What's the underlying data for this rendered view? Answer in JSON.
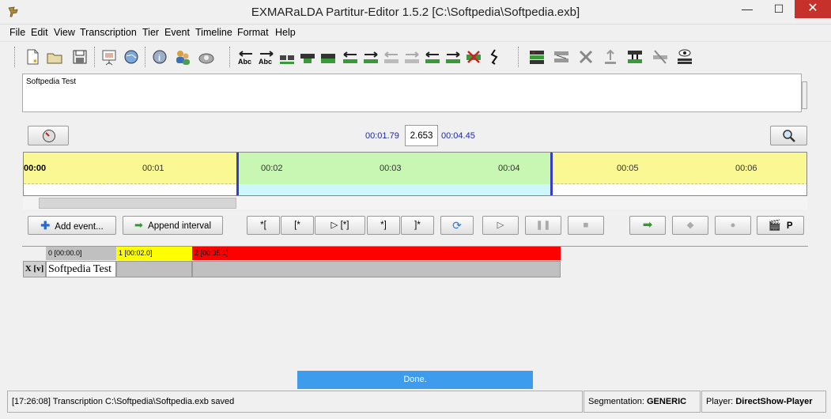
{
  "window": {
    "title": "EXMARaLDA Partitur-Editor 1.5.2 [C:\\Softpedia\\Softpedia.exb]",
    "minimize": "—",
    "maximize": "☐",
    "close": "✕"
  },
  "menu": [
    "File",
    "Edit",
    "View",
    "Transcription",
    "Tier",
    "Event",
    "Timeline",
    "Format",
    "Help"
  ],
  "notes": {
    "text": "Softpedia Test"
  },
  "time_display": {
    "start": "00:01.79",
    "duration": "2.653",
    "end": "00:04.45"
  },
  "timeline": {
    "labels": [
      "00:00",
      "00:01",
      "00:02",
      "00:03",
      "00:04",
      "00:05",
      "00:06"
    ],
    "selection_start_s": 1.79,
    "selection_end_s": 4.45
  },
  "controls": {
    "add_event": "Add event...",
    "append_interval": "Append interval",
    "btn_bracket_start": "*[",
    "btn_star_start": "[*",
    "btn_play_selection": "▷ [*]",
    "btn_star_end": "*]",
    "btn_bracket_end": "]*",
    "btn_p": "P"
  },
  "partitur": {
    "timeline_points": [
      "0 [00:00.0]",
      "1 [00:02.0]",
      "2 [00:35.1]"
    ],
    "tier_label": "X [v]",
    "event_text": "Softpedia Test"
  },
  "progress": {
    "text": "Done."
  },
  "status": {
    "message": "[17:26:08] Transcription C:\\Softpedia\\Softpedia.exb saved",
    "segmentation_label": "Segmentation:",
    "segmentation_value": "GENERIC",
    "player_label": "Player:",
    "player_value": "DirectShow-Player"
  },
  "colors": {
    "timeline_yellow": "#faf892",
    "selection_green": "#c8f7b3",
    "selection_cyan": "#cdf7fb",
    "tl_point0": "#c0c0c0",
    "tl_point1": "#ffff00",
    "tl_point2": "#ff0000",
    "progress_blue": "#3f9ced"
  },
  "icons": [
    "new-file-icon",
    "open-folder-icon",
    "save-icon",
    "presentation-icon",
    "globe-icon",
    "info-icon",
    "users-icon",
    "tape-icon"
  ]
}
